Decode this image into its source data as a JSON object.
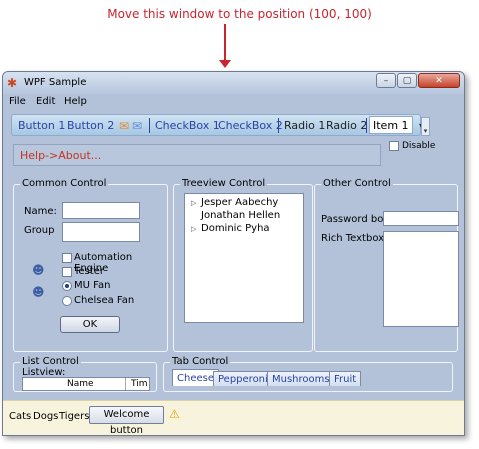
{
  "annotation": {
    "instruction": "Move this window to the position (100, 100)"
  },
  "window": {
    "title": "WPF Sample",
    "app_icon": "bug-icon",
    "caption_buttons": {
      "min": "–",
      "max": "▢",
      "close": "✕"
    }
  },
  "menu": {
    "items": [
      "File",
      "Edit",
      "Help"
    ]
  },
  "toolbar": {
    "button1": "Button 1",
    "button2": "Button 2",
    "checkbox1": "CheckBox 1",
    "checkbox2": "CheckBox 2",
    "radio1": "Radio 1",
    "radio2": "Radio 2",
    "combo_value": "Item 1",
    "combo_arrow": "▾",
    "overflow": "▾"
  },
  "help_text": "Help->About...",
  "disable_label": "Disable",
  "common_control": {
    "title": "Common Control",
    "name_label": "Name:",
    "group_label": "Group",
    "checkboxes": [
      "Automation Engine",
      "Tester"
    ],
    "radios": [
      "MU Fan",
      "Chelsea Fan"
    ],
    "selected_radio": "MU Fan",
    "ok_label": "OK"
  },
  "treeview": {
    "title": "Treeview Control",
    "items": [
      "Jesper Aabechy",
      "Jonathan Hellen",
      "Dominic Pyha"
    ]
  },
  "other_control": {
    "title": "Other Control",
    "password_label": "Password box",
    "rich_label": "Rich Textbox"
  },
  "list_control": {
    "title": "List Control",
    "listview_label": "Listview:",
    "columns": [
      "Name",
      "Tim"
    ]
  },
  "tab_control": {
    "title": "Tab Control",
    "tabs": [
      "Cheese",
      "Pepperoni",
      "Mushrooms",
      "Fruit"
    ],
    "active_tab": "Cheese"
  },
  "statusbar": {
    "items": [
      "Cats",
      "Dogs",
      "Tigers"
    ],
    "button": "Welcome button",
    "warning_icon": "warning-icon"
  },
  "colors": {
    "annotation": "#c8252f",
    "help_text": "#c23322",
    "toolbar_text": "#2a43a6"
  }
}
